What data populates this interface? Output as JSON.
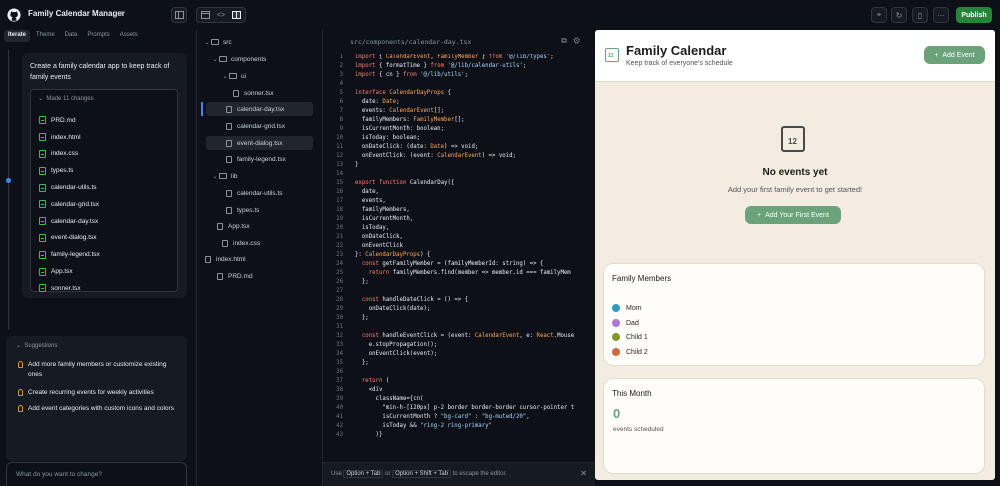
{
  "topbar": {
    "app_title": "Family Calendar Manager",
    "publish_label": "Publish"
  },
  "left_tabs": [
    "Iterate",
    "Theme",
    "Data",
    "Prompts",
    "Assets"
  ],
  "chat": {
    "message": "Create a family calendar app to keep track of family events",
    "changes_label": "Made 11 changes",
    "changes": [
      "PRD.md",
      "index.html",
      "index.css",
      "types.ts",
      "calendar-utils.ts",
      "calendar-grid.tsx",
      "calendar-day.tsx",
      "event-dialog.tsx",
      "family-legend.tsx",
      "App.tsx",
      "sonner.tsx"
    ]
  },
  "suggestions": {
    "heading": "Suggestions",
    "items": [
      "Add more family members or customize existing ones",
      "Create recurring events for weekly activities",
      "Add event categories with custom icons and colors"
    ]
  },
  "chat_input": {
    "placeholder": "What do you want to change?"
  },
  "tree": [
    {
      "label": "src",
      "depth": 0,
      "kind": "folder"
    },
    {
      "label": "components",
      "depth": 1,
      "kind": "folder"
    },
    {
      "label": "ui",
      "depth": 2,
      "kind": "folder"
    },
    {
      "label": "sonner.tsx",
      "depth": 3,
      "kind": "file"
    },
    {
      "label": "calendar-day.tsx",
      "depth": 2,
      "kind": "file",
      "selected": true
    },
    {
      "label": "calendar-grid.tsx",
      "depth": 2,
      "kind": "file"
    },
    {
      "label": "event-dialog.tsx",
      "depth": 2,
      "kind": "file",
      "selected": true
    },
    {
      "label": "family-legend.tsx",
      "depth": 2,
      "kind": "file"
    },
    {
      "label": "lib",
      "depth": 1,
      "kind": "folder"
    },
    {
      "label": "calendar-utils.ts",
      "depth": 2,
      "kind": "file"
    },
    {
      "label": "types.ts",
      "depth": 2,
      "kind": "file"
    },
    {
      "label": "App.tsx",
      "depth": 1,
      "kind": "file"
    },
    {
      "label": "index.css",
      "depth": 1,
      "kind": "file"
    },
    {
      "label": "index.html",
      "depth": 0,
      "kind": "file"
    },
    {
      "label": "PRD.md",
      "depth": 0,
      "kind": "file"
    }
  ],
  "editor": {
    "path": "src/components/calendar-day.tsx",
    "footer": {
      "prefix": "Use",
      "key1": "Option + Tab",
      "or": "or",
      "key2": "Option + Shift + Tab",
      "suffix": "to escape the editor."
    },
    "lines": [
      "import { CalendarEvent, FamilyMember } from '@/lib/types';",
      "import { formatTime } from '@/lib/calendar-utils';",
      "import { cn } from '@/lib/utils';",
      "",
      "interface CalendarDayProps {",
      "  date: Date;",
      "  events: CalendarEvent[];",
      "  familyMembers: FamilyMember[];",
      "  isCurrentMonth: boolean;",
      "  isToday: boolean;",
      "  onDateClick: (date: Date) => void;",
      "  onEventClick: (event: CalendarEvent) => void;",
      "}",
      "",
      "export function CalendarDay({",
      "  date,",
      "  events,",
      "  familyMembers,",
      "  isCurrentMonth,",
      "  isToday,",
      "  onDateClick,",
      "  onEventClick",
      "}: CalendarDayProps) {",
      "  const getFamilyMember = (familyMemberId: string) => {",
      "    return familyMembers.find(member => member.id === familyMem",
      "  };",
      "",
      "  const handleDateClick = () => {",
      "    onDateClick(date);",
      "  };",
      "",
      "  const handleEventClick = (event: CalendarEvent, e: React.Mouse",
      "    e.stopPropagation();",
      "    onEventClick(event);",
      "  };",
      "",
      "  return (",
      "    <div",
      "      className={cn(",
      "        \"min-h-[120px] p-2 border border-border cursor-pointer t",
      "        isCurrentMonth ? \"bg-card\" : \"bg-muted/20\",",
      "        isToday && \"ring-2 ring-primary\"",
      "      )}"
    ]
  },
  "preview": {
    "title": "Family Calendar",
    "subtitle": "Keep track of everyone's schedule",
    "add_event": "Add Event",
    "calendar_icon_text": "12",
    "empty_title": "No events yet",
    "empty_sub": "Add your first family event to get started!",
    "first_event": "Add Your First Event",
    "members_title": "Family Members",
    "members": [
      {
        "name": "Mom",
        "color": "#2b9cc2"
      },
      {
        "name": "Dad",
        "color": "#b275d9"
      },
      {
        "name": "Child 1",
        "color": "#7d9a1c"
      },
      {
        "name": "Child 2",
        "color": "#d06a3c"
      }
    ],
    "month_title": "This Month",
    "month_count": "0",
    "month_label": "events scheduled"
  },
  "colors": {
    "accent": "#6aa27a",
    "publish": "#238636",
    "preview_bg": "#f3ede1"
  }
}
